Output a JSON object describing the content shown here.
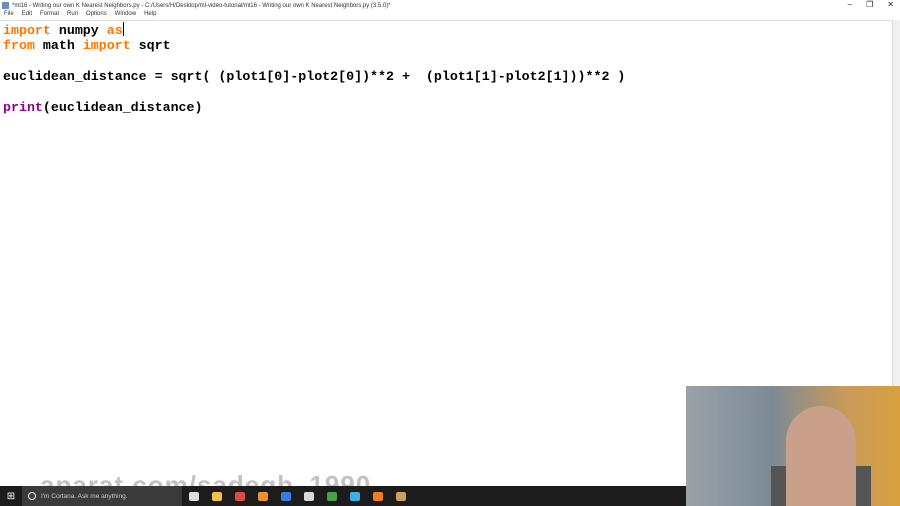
{
  "window": {
    "title": "*ml16 - Writing our own K Nearest Neighbors.py - C:/Users/H/Desktop/ml-video-tutorial/ml16 - Writing our own K Nearest Neighbors.py (3.5.0)*",
    "minimize": "–",
    "maximize": "❐",
    "close": "✕"
  },
  "menu": [
    "File",
    "Edit",
    "Format",
    "Run",
    "Options",
    "Window",
    "Help"
  ],
  "code": {
    "l1": {
      "kw1": "import",
      "t1": " numpy ",
      "kw2": "as"
    },
    "l2": {
      "kw1": "from",
      "t1": " math ",
      "kw2": "import",
      "t2": " sqrt"
    },
    "l4": "euclidean_distance = sqrt( (plot1[0]-plot2[0])**2 +  (plot1[1]-plot2[1]))**2 )",
    "l6": {
      "bi": "print",
      "t1": "(euclidean_distance)"
    }
  },
  "watermark": "aparat.com/sadegh_1990",
  "taskbar": {
    "cortana": "I'm Cortana. Ask me anything.",
    "icons": [
      {
        "name": "task-view",
        "color": "#dddddd"
      },
      {
        "name": "file-explorer",
        "color": "#f3c04a"
      },
      {
        "name": "chrome",
        "color": "#e04a3a"
      },
      {
        "name": "media-player",
        "color": "#f09030"
      },
      {
        "name": "app-blue",
        "color": "#3a7be0"
      },
      {
        "name": "idle-python",
        "color": "#d8d8d8"
      },
      {
        "name": "network-app",
        "color": "#4aa04a"
      },
      {
        "name": "chat",
        "color": "#3ab0e8"
      },
      {
        "name": "firefox",
        "color": "#f08020"
      },
      {
        "name": "app-box",
        "color": "#c8a060"
      }
    ]
  }
}
